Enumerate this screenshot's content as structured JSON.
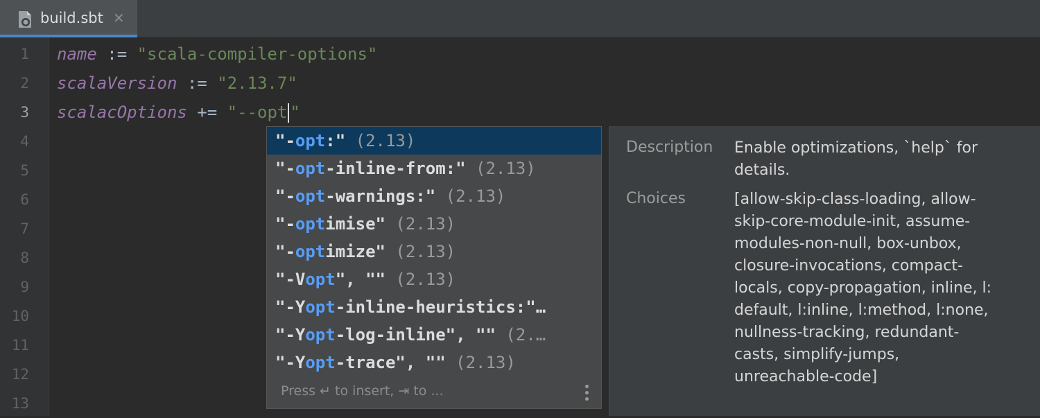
{
  "tab": {
    "label": "build.sbt",
    "close": "✕"
  },
  "gutter": {
    "lines": [
      "1",
      "2",
      "3",
      "4",
      "5",
      "6",
      "7",
      "8",
      "9",
      "10",
      "11",
      "12",
      "13"
    ]
  },
  "code": {
    "line1": {
      "key": "name",
      "op": " := ",
      "value": "\"scala-compiler-options\""
    },
    "line2": {
      "key": "scalaVersion",
      "op": " := ",
      "value": "\"2.13.7\""
    },
    "line3": {
      "key": "scalacOptions",
      "op": " += ",
      "value_before_caret": "\"--opt",
      "value_after_caret": "\""
    }
  },
  "completion": {
    "items": [
      {
        "prefix": "\"-",
        "match": "opt",
        "rest": ":\"",
        "tail": " (2.13)"
      },
      {
        "prefix": "\"-",
        "match": "opt",
        "rest": "-inline-from:\"",
        "tail": " (2.13)"
      },
      {
        "prefix": "\"-",
        "match": "opt",
        "rest": "-warnings:\"",
        "tail": " (2.13)"
      },
      {
        "prefix": "\"-",
        "match": "opt",
        "rest": "imise\"",
        "tail": " (2.13)"
      },
      {
        "prefix": "\"-",
        "match": "opt",
        "rest": "imize\"",
        "tail": " (2.13)"
      },
      {
        "prefix": "\"-V",
        "match": "opt",
        "rest": "\", \"\"",
        "tail": " (2.13)"
      },
      {
        "prefix": "\"-Y",
        "match": "opt",
        "rest": "-inline-heuristics:\"…",
        "tail": ""
      },
      {
        "prefix": "\"-Y",
        "match": "opt",
        "rest": "-log-inline\", \"\"",
        "tail": " (2.…"
      },
      {
        "prefix": "\"-Y",
        "match": "opt",
        "rest": "-trace\", \"\"",
        "tail": " (2.13)"
      }
    ],
    "footer": "Press ↵ to insert, ⇥ to ..."
  },
  "documentation": {
    "description_label": "Description",
    "description_lines": [
      "Enable optimizations, `help` for",
      "details."
    ],
    "choices_label": "Choices",
    "choices_lines": [
      "[allow-skip-class-loading, allow-",
      "skip-core-module-init, assume-",
      "modules-non-null, box-unbox,",
      "closure-invocations, compact-",
      "locals, copy-propagation, inline, l:",
      "default, l:inline, l:method, l:none,",
      "nullness-tracking, redundant-",
      "casts, simplify-jumps,",
      "unreachable-code]"
    ]
  },
  "icons": {
    "tab_icon": "sbt-file-icon",
    "more": "more-vertical-icon"
  },
  "colors": {
    "accent": "#4a88c7",
    "selection": "#0d3a5c",
    "match": "#589df6"
  }
}
